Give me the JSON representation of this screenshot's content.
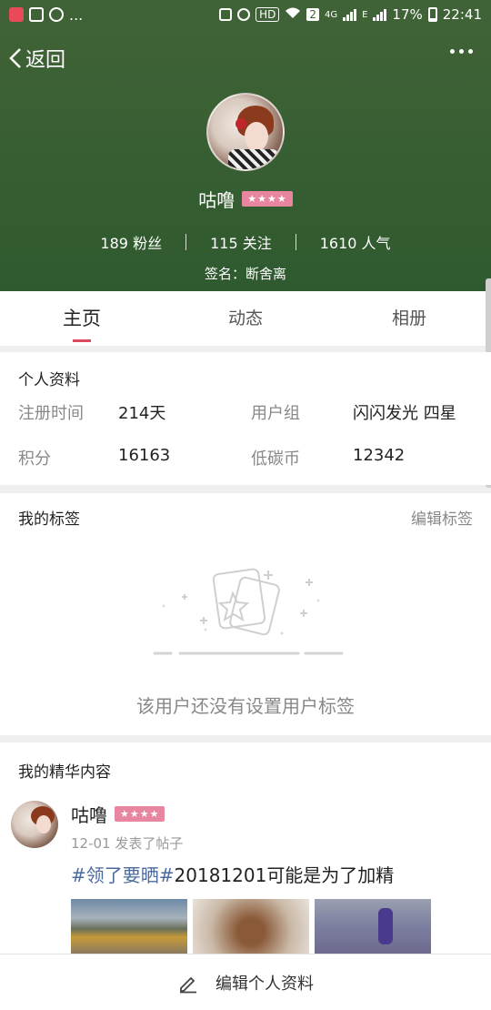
{
  "status_bar": {
    "hd": "HD",
    "sim": "2",
    "network": "4G",
    "network2": "E",
    "battery": "17%",
    "time": "22:41",
    "dots": "..."
  },
  "header": {
    "back_label": "返回",
    "username": "咕噜",
    "level_badge": "★★★★",
    "stats": [
      {
        "value": "189",
        "label": "粉丝"
      },
      {
        "value": "115",
        "label": "关注"
      },
      {
        "value": "1610",
        "label": "人气"
      }
    ],
    "signature": "签名：断舍离",
    "bg_color": "#3f6236"
  },
  "tabs": [
    "主页",
    "动态",
    "相册"
  ],
  "profile": {
    "title": "个人资料",
    "fields": [
      {
        "key": "注册时间",
        "value": "214天"
      },
      {
        "key": "用户组",
        "value": "闪闪发光 四星"
      },
      {
        "key": "积分",
        "value": "16163"
      },
      {
        "key": "低碳币",
        "value": "12342"
      }
    ]
  },
  "tags": {
    "title": "我的标签",
    "edit_label": "编辑标签",
    "empty_text": "该用户还没有设置用户标签"
  },
  "featured": {
    "title": "我的精华内容",
    "post": {
      "author": "咕噜",
      "badge": "★★★★",
      "meta": "12-01  发表了帖子",
      "topic": "#领了要晒#",
      "text": "20181201可能是为了加精"
    }
  },
  "bottom_bar": {
    "label": "编辑个人资料"
  },
  "colors": {
    "accent": "#d94a5f",
    "badge": "#e8859f",
    "topic": "#4a6a9e"
  }
}
